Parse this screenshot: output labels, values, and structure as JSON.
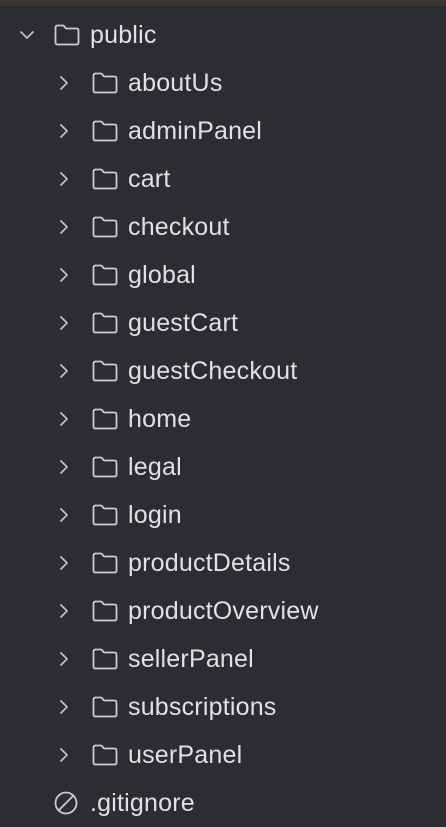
{
  "tree": {
    "root": {
      "label": "public",
      "expanded": true
    },
    "folders": [
      {
        "label": "aboutUs"
      },
      {
        "label": "adminPanel"
      },
      {
        "label": "cart"
      },
      {
        "label": "checkout"
      },
      {
        "label": "global"
      },
      {
        "label": "guestCart"
      },
      {
        "label": "guestCheckout"
      },
      {
        "label": "home"
      },
      {
        "label": "legal"
      },
      {
        "label": "login"
      },
      {
        "label": "productDetails"
      },
      {
        "label": "productOverview"
      },
      {
        "label": "sellerPanel"
      },
      {
        "label": "subscriptions"
      },
      {
        "label": "userPanel"
      }
    ],
    "file": {
      "label": ".gitignore",
      "icon": "ignore-file-icon"
    }
  },
  "icons": {
    "chevron_color": "#bcbec4",
    "folder_color": "#c9ccd3"
  }
}
